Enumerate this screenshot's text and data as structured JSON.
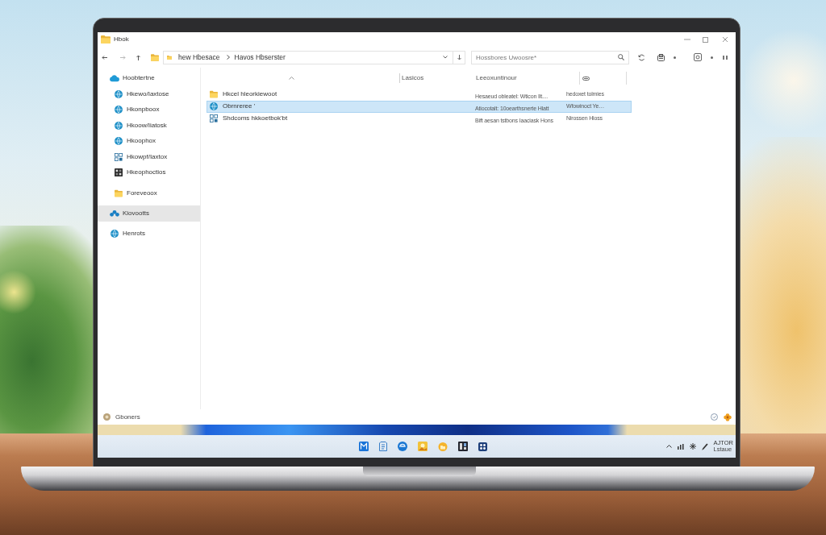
{
  "window": {
    "title": "Hbok"
  },
  "address_bar": {
    "breadcrumbs": [
      "hew Hbesace",
      "Havos Hbserster"
    ]
  },
  "search": {
    "placeholder": "Hossbores Uwoosre*"
  },
  "sidebar": {
    "items": [
      {
        "label": "Hoobtertne",
        "kind": "cloud",
        "selected": false,
        "children": [
          {
            "label": "Hkewo/Iaxtose",
            "kind": "globe",
            "selected": false
          },
          {
            "label": "Hkonpboox",
            "kind": "globe",
            "selected": false
          },
          {
            "label": "Hkoow/Iiatosk",
            "kind": "globe",
            "selected": false
          },
          {
            "label": "Hkoophox",
            "kind": "globe",
            "selected": false
          },
          {
            "label": "Hkowpf/Iaxtox",
            "kind": "grid",
            "selected": false
          },
          {
            "label": "Hkeophoctios",
            "kind": "image",
            "selected": false
          },
          {
            "label": "Foreveoox",
            "kind": "folder",
            "selected": false
          }
        ]
      },
      {
        "label": "Kiovootts",
        "kind": "network",
        "selected": true
      },
      {
        "label": "Henrots",
        "kind": "globe",
        "selected": false
      }
    ]
  },
  "table": {
    "columns": [
      "Lasicos",
      "Leeoxuntinour"
    ],
    "rows": [
      {
        "kind": "folder",
        "name": "Hkcel hleorkiewoot",
        "column_3": "Hesaeud obleatel: Wticon Ilt....",
        "column_4": "hedoxet tolmies",
        "selected": false
      },
      {
        "kind": "globe",
        "name": "Obrnreree '",
        "column_3": "Atiocotalt: 10oearthsnerte Hlatt",
        "column_4": "Wfowinoct Ye…",
        "selected": true
      },
      {
        "kind": "grid",
        "name": "Shdcoms hkkoetbok'bt",
        "column_3": "Bift aesan tstbons Iaaciask Hons",
        "column_4": "Nirossen Hioss",
        "selected": false
      }
    ]
  },
  "status_bar": {
    "text": "Gboners"
  },
  "taskbar": {
    "clock": {
      "time": "AJTOR",
      "date": "Lstaue"
    }
  }
}
